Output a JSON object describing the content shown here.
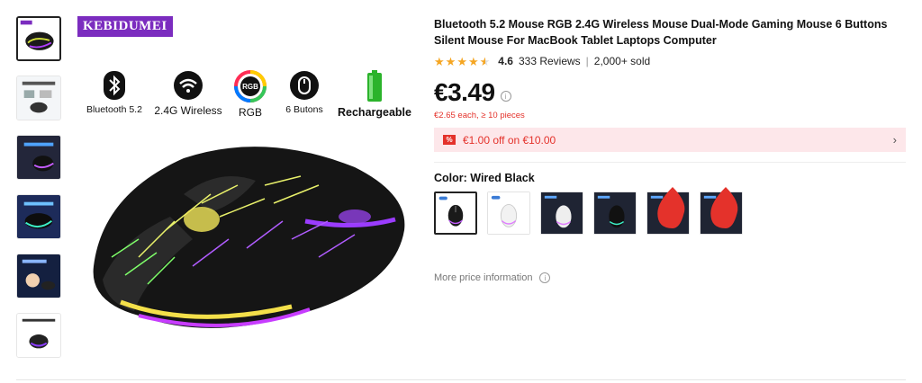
{
  "brand": "KEBIDUMEI",
  "features": [
    {
      "icon": "bluetooth-icon",
      "label": "Bluetooth 5.2"
    },
    {
      "icon": "wifi-icon",
      "label": "2.4G Wireless"
    },
    {
      "icon": "rgb-icon",
      "label": "RGB",
      "icon_text": "RGB"
    },
    {
      "icon": "mouse-icon",
      "label": "6 Butons"
    },
    {
      "icon": "battery-icon",
      "label": "Rechargeable"
    }
  ],
  "product": {
    "title": "Bluetooth 5.2 Mouse RGB 2.4G Wireless Mouse Dual-Mode Gaming Mouse 6 Buttons Silent Mouse For MacBook Tablet Laptops Computer",
    "rating": "4.6",
    "stars": 4.5,
    "reviews": "333 Reviews",
    "sold": "2,000+ sold",
    "price": "€3.49",
    "bulk_price": "€2.65 each, ≥ 10 pieces",
    "coupon": "€1.00 off on €10.00",
    "color_label": "Color: Wired Black",
    "more_price": "More price information"
  },
  "colors": {
    "star": "#f5a623",
    "sale_red": "#e4322b",
    "coupon_bg": "#fde7ea",
    "brand_purple": "#7b2cbf"
  }
}
